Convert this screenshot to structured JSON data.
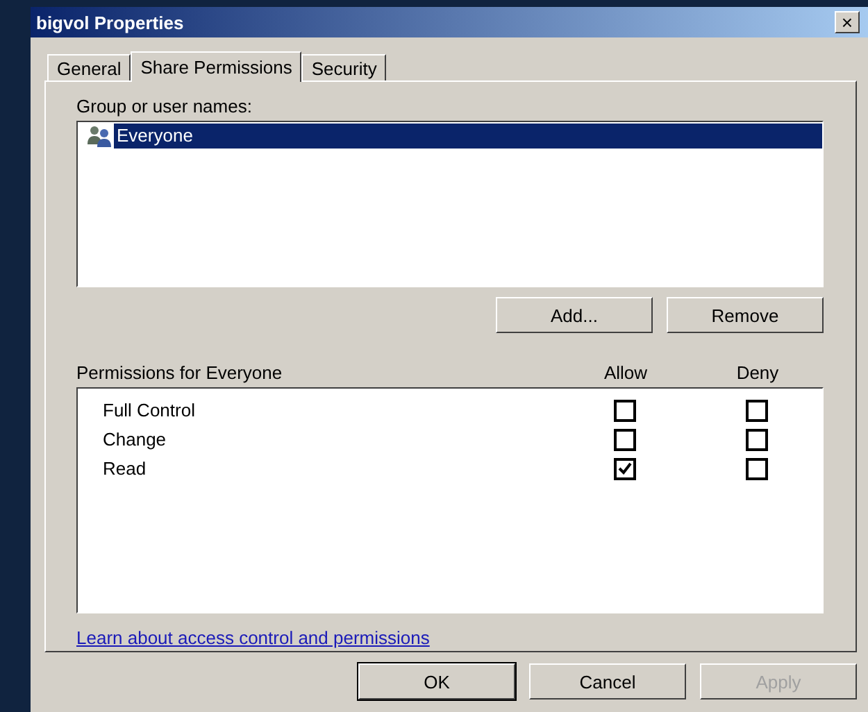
{
  "window": {
    "title": "bigvol Properties",
    "close": "×"
  },
  "tabs": [
    {
      "label": "General",
      "selected": false
    },
    {
      "label": "Share Permissions",
      "selected": true
    },
    {
      "label": "Security",
      "selected": false
    }
  ],
  "group_label": "Group or user names:",
  "users": [
    {
      "name": "Everyone",
      "selected": true
    }
  ],
  "user_buttons": [
    {
      "label": "Add...",
      "disabled": false
    },
    {
      "label": "Remove",
      "disabled": false
    }
  ],
  "permissions": {
    "label": "Permissions for Everyone",
    "allow_header": "Allow",
    "deny_header": "Deny",
    "rows": [
      {
        "name": "Full Control",
        "allow": false,
        "deny": false
      },
      {
        "name": "Change",
        "allow": false,
        "deny": false
      },
      {
        "name": "Read",
        "allow": true,
        "deny": false
      }
    ]
  },
  "link": "Learn about access control and permissions",
  "buttons": [
    {
      "label": "OK",
      "disabled": false,
      "default": true
    },
    {
      "label": "Cancel",
      "disabled": false,
      "default": false
    },
    {
      "label": "Apply",
      "disabled": true,
      "default": false
    }
  ]
}
